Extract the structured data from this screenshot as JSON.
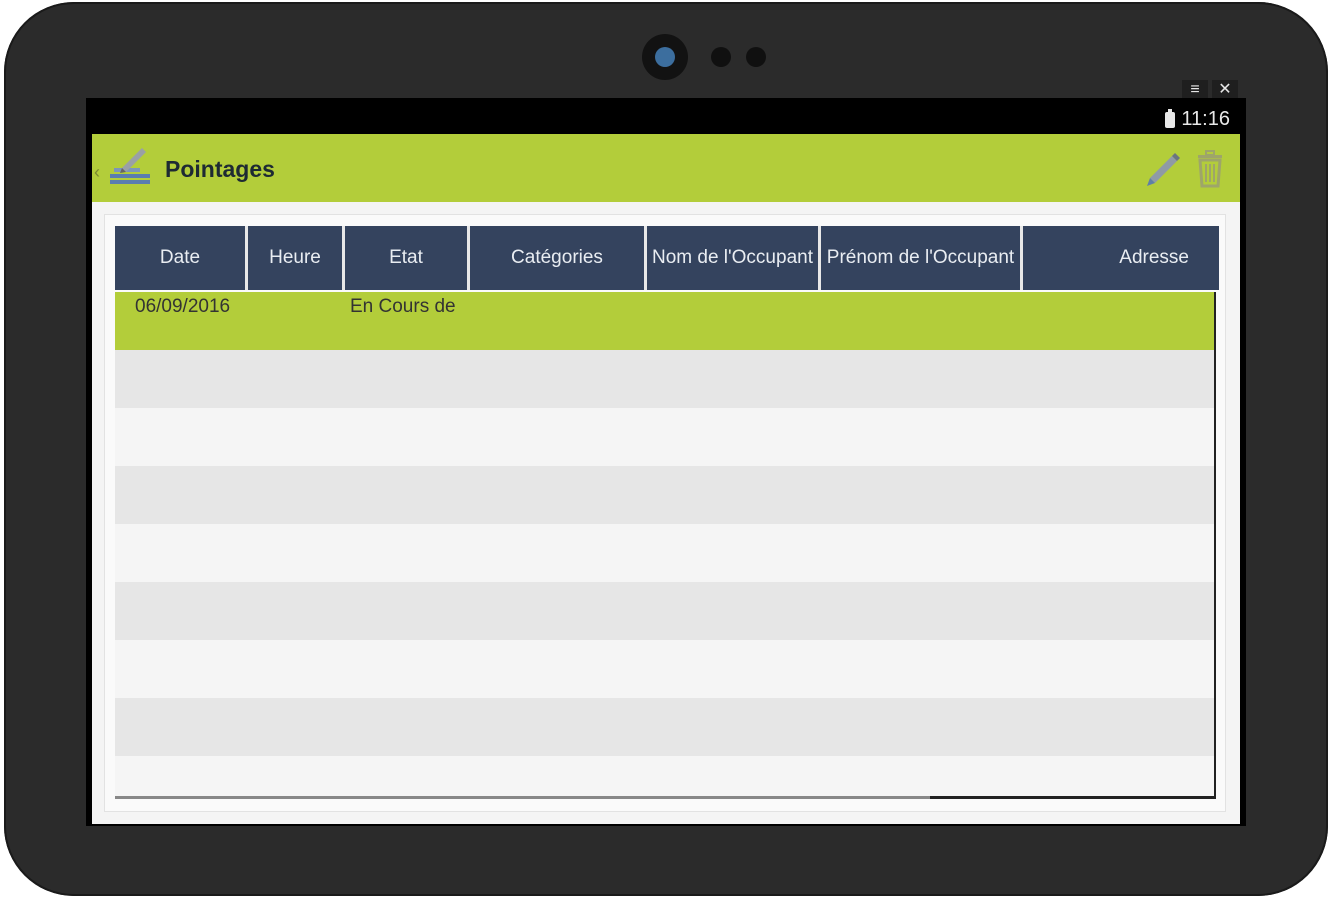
{
  "status_bar": {
    "time": "11:16"
  },
  "system_buttons": {
    "menu": "≡",
    "close": "✕"
  },
  "app_bar": {
    "title": "Pointages",
    "back": "‹"
  },
  "table": {
    "columns": [
      "Date",
      "Heure",
      "Etat",
      "Catégories",
      "Nom de l'Occupant",
      "Prénom de l'Occupant",
      "Adresse"
    ],
    "rows": [
      [
        "06/09/2016",
        "",
        "En Cours de Saisie",
        "",
        "",
        "",
        ""
      ]
    ],
    "selected_row": 0
  },
  "colors": {
    "accent": "#b3cd3a",
    "header": "#34435e",
    "frame": "#2b2b2b"
  }
}
